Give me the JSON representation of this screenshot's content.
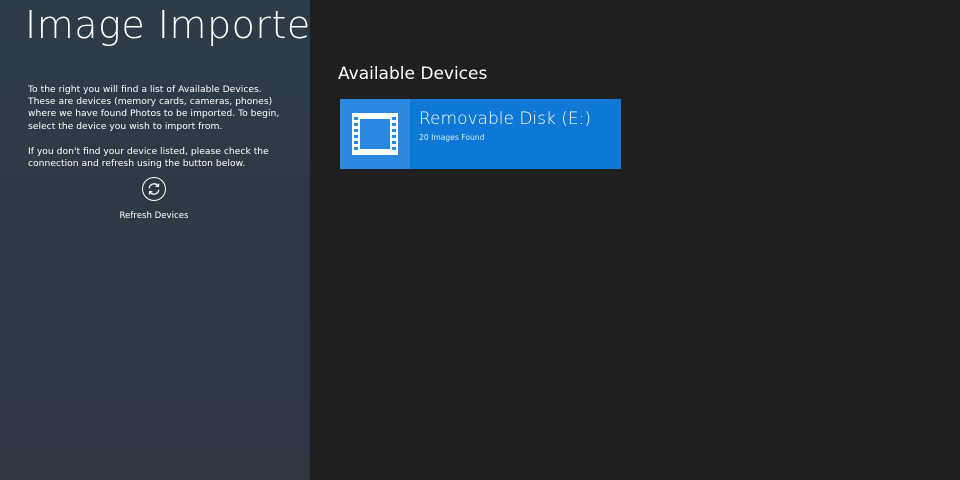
{
  "app": {
    "title": "Image Importer"
  },
  "sidebar": {
    "intro_paragraph_1": "To the right you will find a list of Available Devices. These are devices (memory cards, cameras, phones) where we have found Photos to be imported. To begin, select the device you wish to import from.",
    "intro_paragraph_2": "If you don't find your device listed, please check the connection and refresh using the button below.",
    "refresh_button": {
      "label": "Refresh Devices",
      "icon": "refresh-icon"
    }
  },
  "main": {
    "section_title": "Available Devices",
    "devices": [
      {
        "name": "Removable Disk (E:)",
        "status": "20 Images Found",
        "icon": "film-frame-icon"
      }
    ]
  },
  "colors": {
    "sidebar_bg": "#2d3a48",
    "main_bg": "#1f1f1f",
    "tile_bg": "#0e78d6",
    "tile_icon_bg": "#2a88e0"
  }
}
